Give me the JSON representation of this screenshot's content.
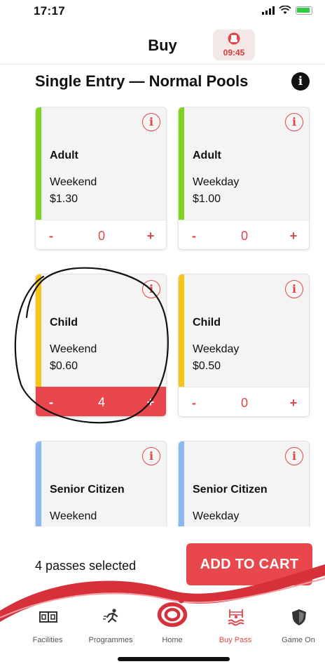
{
  "status_bar": {
    "time": "17:17"
  },
  "header": {
    "title": "Buy",
    "timer": "09:45"
  },
  "section": {
    "title": "Single Entry — Normal Pools",
    "info_icon": "i"
  },
  "colors": {
    "accent": "#e8484d",
    "adult": "#7ed321",
    "child": "#f5c518",
    "senior": "#8ab8f0"
  },
  "cards": [
    {
      "type": "Adult",
      "day": "Weekend",
      "price": "$1.30",
      "qty": "0",
      "minus": "-",
      "plus": "+",
      "info": "i"
    },
    {
      "type": "Adult",
      "day": "Weekday",
      "price": "$1.00",
      "qty": "0",
      "minus": "-",
      "plus": "+",
      "info": "i"
    },
    {
      "type": "Child",
      "day": "Weekend",
      "price": "$0.60",
      "qty": "4",
      "minus": "-",
      "plus": "+",
      "info": "i"
    },
    {
      "type": "Child",
      "day": "Weekday",
      "price": "$0.50",
      "qty": "0",
      "minus": "-",
      "plus": "+",
      "info": "i"
    },
    {
      "type": "Senior Citizen",
      "day": "Weekend",
      "info": "i"
    },
    {
      "type": "Senior Citizen",
      "day": "Weekday",
      "info": "i"
    }
  ],
  "cart": {
    "summary": "4 passes selected",
    "button": "ADD TO CART"
  },
  "tabs": [
    {
      "label": "Facilities",
      "icon": "facilities-icon"
    },
    {
      "label": "Programmes",
      "icon": "running-person-icon"
    },
    {
      "label": "Home",
      "icon": "home-logo-icon"
    },
    {
      "label": "Buy Pass",
      "icon": "swimmer-icon",
      "active": true
    },
    {
      "label": "Game On",
      "icon": "shield-icon"
    }
  ]
}
